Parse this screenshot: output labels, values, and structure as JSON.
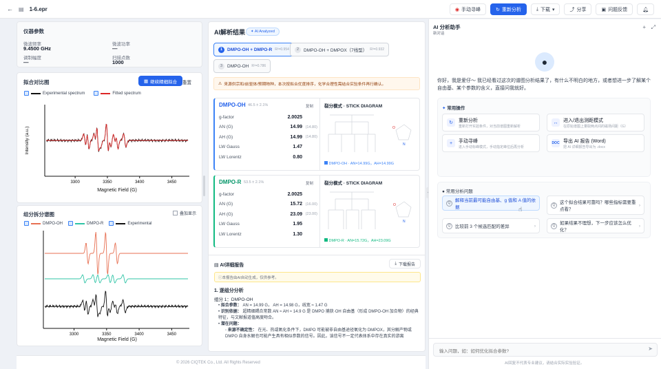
{
  "app": {
    "filename": "1-6.epr",
    "back_icon": "arrow-left-icon"
  },
  "toolbar": {
    "manual": "手动寻峰",
    "reanalyze": "重新分析",
    "download": "下载",
    "share": "分享",
    "feedback": "问题反馈"
  },
  "instrument": {
    "title": "仪器参数",
    "fields": [
      {
        "label": "微波频率",
        "value": "9.4500 GHz"
      },
      {
        "label": "微波功率",
        "value": "—"
      },
      {
        "label": "调制幅度",
        "value": "—"
      },
      {
        "label": "扫描点数",
        "value": "1000"
      }
    ]
  },
  "fit_compare": {
    "title": "拟合对比图",
    "continue_btn": "继续精细拟合",
    "reset_btn": "重置",
    "legend_exp": "Experimental spectrum",
    "legend_fit": "Fitted spectrum",
    "ylabel": "Intensity (a.u.)",
    "xlabel": "Magnetic Field (G)",
    "ticks": [
      "3300",
      "3350",
      "3400",
      "3450"
    ]
  },
  "components": {
    "title": "组分拆分谱图",
    "overlay": "叠加显示",
    "legend": [
      "DMPO-OH",
      "DMPO-R",
      "Experimental"
    ],
    "xlabel": "Magnetic Field (G)",
    "ticks": [
      "3300",
      "3350",
      "3400",
      "3450"
    ]
  },
  "analysis": {
    "title": "AI解析结果",
    "badge": "AI Analyzed",
    "tabs": [
      {
        "num": "1",
        "label": "DMPO-OH + DMPO-R",
        "r2": "R²=0.954"
      },
      {
        "num": "2",
        "label": "DMPO-OH + DMPOX（7线型）",
        "r2": "R²=0.932"
      },
      {
        "num": "3",
        "label": "DMPO-OH",
        "r2": "R²=0.786"
      }
    ],
    "notice": "来源供宗和/前驱体/预期物种，本次按拟合优度排序，化学合理性需结合实验条件再行确认。"
  },
  "species": [
    {
      "name": "DMPO-OH",
      "pct": "46.5 ± 2.1%",
      "copy": "复制",
      "rows": [
        {
          "k": "g-factor",
          "v": "2.0025",
          "m": ""
        },
        {
          "k": "AN (G)",
          "v": "14.99",
          "m": "(14.80)"
        },
        {
          "k": "AH (G)",
          "v": "14.99",
          "m": "(14.80)"
        },
        {
          "k": "LW Gauss",
          "v": "1.47",
          "m": ""
        },
        {
          "k": "LW Lorentz",
          "v": "0.80",
          "m": ""
        }
      ],
      "diagram_title": "裂分模式 · STICK DIAGRAM",
      "caption": "DMPO-OH · AN=14.99G，AH=14.99G"
    },
    {
      "name": "DMPO-R",
      "pct": "53.5 ± 2.1%",
      "copy": "复制",
      "rows": [
        {
          "k": "g-factor",
          "v": "2.0025",
          "m": ""
        },
        {
          "k": "AN (G)",
          "v": "15.72",
          "m": "(16.00)"
        },
        {
          "k": "AH (G)",
          "v": "23.09",
          "m": "(23.00)"
        },
        {
          "k": "LW Gauss",
          "v": "1.95",
          "m": ""
        },
        {
          "k": "LW Lorentz",
          "v": "1.30",
          "m": ""
        }
      ],
      "diagram_title": "裂分模式 · STICK DIAGRAM",
      "caption": "DMPO-R · AN=15.72G，AH=23.09G"
    }
  ],
  "report": {
    "title": "AI详细报告",
    "download": "下载报告",
    "disclaimer": "本报告由AI自动生成，仅供参考。",
    "h1": "1. 逐组分分析",
    "h2": "组分 1：DMPO-OH",
    "b1k": "拟合参数：",
    "b1": "AN = 14.99 G， AH = 14.98 G，线宽 ≈ 1.47 G",
    "b2k": "识别依据：",
    "b2": "超精细耦合常数 AN ≈ AH ≈ 14.9 G 是 DMPO 捕获·OH 自由基（形成 DMPO-OH 加合物）的经典特征，与文献报道值高度吻合。",
    "b3k": "潜在问题：",
    "b4k": "来源不确定性：",
    "b4": "在光、热或氧化条件下，DMPO 可能被非自由基途径氧化为 DMPOX，其分解产物或 DMPO 自身水解也可能产生具有相似参数的信号。因此，该信号不一定代表体系中存在真实的游离"
  },
  "footer": "© 2026 CIQTEK Co., Ltd. All Rights Reserved",
  "assistant": {
    "title": "AI 分析助手",
    "subtitle": "新对话",
    "greeting": "你好，我是爱仔～ 我已经看过这次的谱图分析结果了，有什么不明白的地方，或者想进一步了解某个自由基、某个参数的含义，直接问我就好。",
    "common_ops": "常用操作",
    "actions": [
      {
        "icon": "refresh-icon",
        "t": "重新分析",
        "d": "重新打开实验条件，对当前谱图重新解析"
      },
      {
        "icon": "range-icon",
        "t": "进入/退出测距模式",
        "d": "在原始谱图上量取两点间的磁场间距（G）"
      },
      {
        "icon": "plus-icon",
        "t": "手动寻峰",
        "d": "进入手动标峰模式，手动指定峰位后再分析"
      },
      {
        "icon": "doc-icon",
        "t": "导出 AI 报告 (Word)",
        "d": "把 AI 详细报告导出为 .docx"
      }
    ],
    "common_q": "常用分析问题",
    "questions": [
      "解释当前最可能自由基、g 值和 A 值的依据",
      "这个拟合结果可靠吗？哪些指标需要重点看？",
      "比较前 3 个候选匹配的差异",
      "如果结果不理想，下一步应该怎么优化？"
    ],
    "input_placeholder": "输入问题，如：如何优化拟合参数?",
    "hint": "AI回复不代表专业建议，请结合实际实验验证。"
  },
  "colors": {
    "accent": "#2563eb",
    "fit_red": "#dc2626",
    "dmpo_oh": "#e76f51",
    "dmpo_r": "#2ec4a6"
  }
}
